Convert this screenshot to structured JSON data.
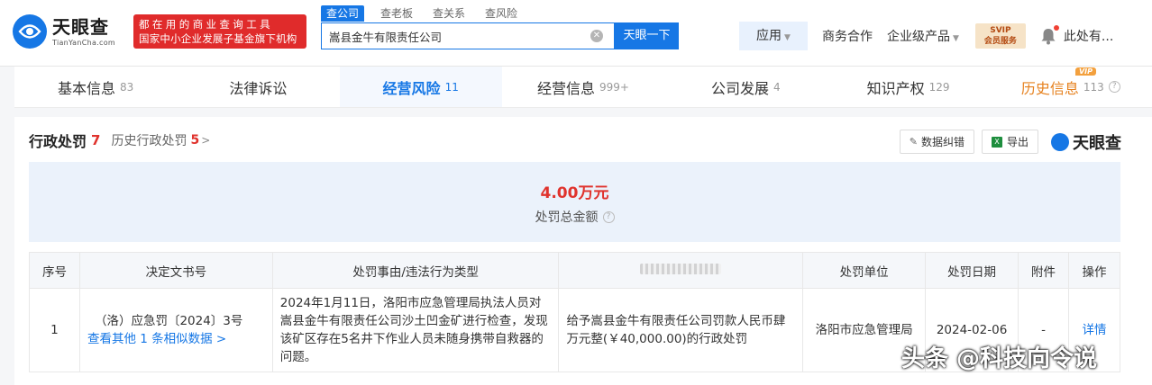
{
  "header": {
    "logo_cn": "天眼查",
    "logo_en": "TianYanCha.com",
    "slogan_line1": "都在用的商业查询工具",
    "slogan_line2": "国家中小企业发展子基金旗下机构",
    "search_tabs": [
      "查公司",
      "查老板",
      "查关系",
      "查风险"
    ],
    "search_value": "嵩县金牛有限责任公司",
    "search_button": "天眼一下",
    "nav": {
      "app": "应用",
      "business": "商务合作",
      "enterprise": "企业级产品",
      "svip_line1": "SVIP",
      "svip_line2": "会员服务",
      "user": "此处有..."
    }
  },
  "tabs": [
    {
      "label": "基本信息",
      "count": "83"
    },
    {
      "label": "法律诉讼",
      "count": ""
    },
    {
      "label": "经营风险",
      "count": "11"
    },
    {
      "label": "经营信息",
      "count": "999+"
    },
    {
      "label": "公司发展",
      "count": "4"
    },
    {
      "label": "知识产权",
      "count": "129"
    },
    {
      "label": "历史信息",
      "count": "113",
      "tag": "VIP"
    }
  ],
  "section": {
    "title": "行政处罚",
    "count": "7",
    "history_label": "历史行政处罚",
    "history_count": "5",
    "correct_button": "数据纠错",
    "export_button": "导出",
    "brand": "天眼查",
    "summary_value": "4.00万元",
    "summary_label": "处罚总金额"
  },
  "table": {
    "headers": [
      "序号",
      "决定文书号",
      "处罚事由/违法行为类型",
      "",
      "处罚单位",
      "处罚日期",
      "附件",
      "操作"
    ],
    "rows": [
      {
        "index": "1",
        "doc_no": "（洛）应急罚〔2024〕3号",
        "similar": "查看其他 1 条相似数据",
        "reason": "2024年1月11日，洛阳市应急管理局执法人员对嵩县金牛有限责任公司沙土凹金矿进行检查，发现该矿区存在5名井下作业人员未随身携带自救器的问题。",
        "content": "给予嵩县金牛有限责任公司罚款人民币肆万元整(￥40,000.00)的行政处罚",
        "unit": "洛阳市应急管理局",
        "date": "2024-02-06",
        "attachment": "-",
        "action": "详情"
      }
    ]
  },
  "watermark": "头条 @科技向令说"
}
